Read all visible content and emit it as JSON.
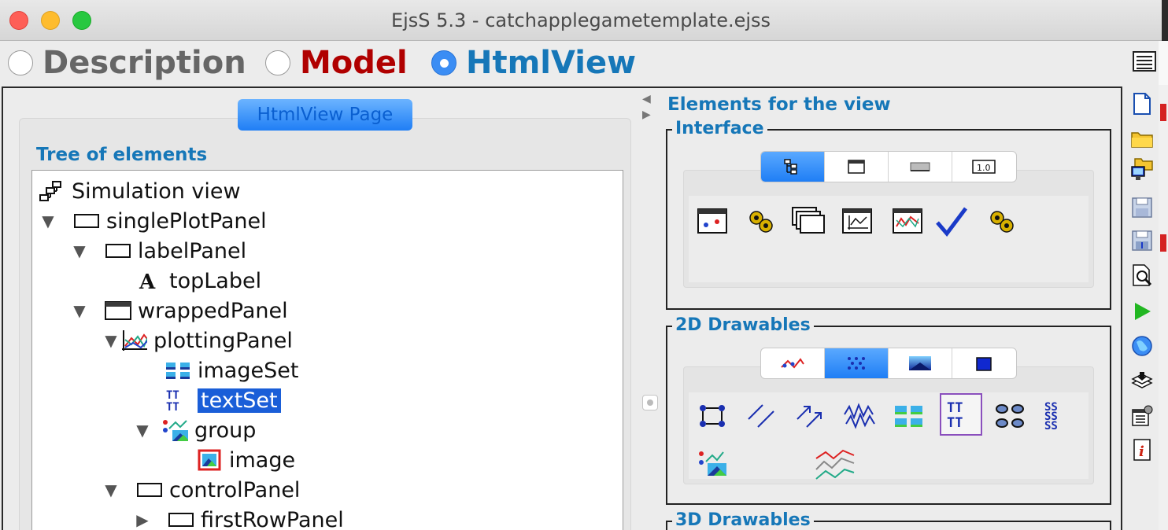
{
  "window": {
    "title": "EjsS 5.3 - catchapplegametemplate.ejss"
  },
  "modes": [
    {
      "label": "Description",
      "selected": false
    },
    {
      "label": "Model",
      "selected": false
    },
    {
      "label": "HtmlView",
      "selected": true
    }
  ],
  "page_tab": {
    "label": "HtmlView Page"
  },
  "tree": {
    "title": "Tree of elements",
    "nodes": [
      {
        "label": "Simulation view",
        "icon": "simulation-view-icon",
        "depth": 0,
        "expander": "none",
        "selected": false
      },
      {
        "label": "singlePlotPanel",
        "icon": "panel-icon",
        "depth": 1,
        "expander": "expanded",
        "selected": false
      },
      {
        "label": "labelPanel",
        "icon": "panel-icon",
        "depth": 2,
        "expander": "expanded",
        "selected": false
      },
      {
        "label": "topLabel",
        "icon": "label-icon",
        "depth": 3,
        "expander": "none",
        "selected": false
      },
      {
        "label": "wrappedPanel",
        "icon": "wrapped-panel-icon",
        "depth": 2,
        "expander": "expanded",
        "selected": false
      },
      {
        "label": "plottingPanel",
        "icon": "plotting-panel-icon",
        "depth": 3,
        "expander": "expanded",
        "selected": false
      },
      {
        "label": "imageSet",
        "icon": "image-set-icon",
        "depth": 4,
        "expander": "none",
        "selected": false
      },
      {
        "label": "textSet",
        "icon": "text-set-icon",
        "depth": 4,
        "expander": "none",
        "selected": true
      },
      {
        "label": "group",
        "icon": "group-icon",
        "depth": 4,
        "expander": "expanded",
        "selected": false
      },
      {
        "label": "image",
        "icon": "image-icon",
        "depth": 5,
        "expander": "none",
        "selected": false
      },
      {
        "label": "controlPanel",
        "icon": "panel-icon",
        "depth": 3,
        "expander": "expanded",
        "selected": false
      },
      {
        "label": "firstRowPanel",
        "icon": "panel-icon",
        "depth": 4,
        "expander": "collapsed",
        "selected": false
      }
    ]
  },
  "elements": {
    "title": "Elements for the view",
    "groups": [
      {
        "title": "Interface",
        "tabs": [
          "tree-tab-icon",
          "window-tab-icon",
          "button-tab-icon",
          "field-tab-icon"
        ],
        "selected_tab": 0,
        "items": [
          "drawing-panel-icon",
          "gear-wrapped-icon",
          "stacked-panels-icon",
          "plotting-panel-icon",
          "plotting-panel-trace-icon",
          "check-icon",
          "gear-icon"
        ]
      },
      {
        "title": "2D Drawables",
        "tabs": [
          "curve-tab-icon",
          "dots-tab-icon",
          "gradient-tab-icon",
          "bar-tab-icon"
        ],
        "selected_tab": 1,
        "items": [
          "arrows-set-icon",
          "segment-set-icon",
          "arrow-set-icon",
          "trail-set-icon",
          "image-set-icon",
          "text-set-icon",
          "shape-set-icon",
          "spring-set-icon",
          "group-icon",
          "trace-set-icon"
        ],
        "selected_item": 5
      },
      {
        "title": "3D Drawables"
      }
    ]
  },
  "tools": [
    "new-file-icon",
    "open-folder-icon",
    "open-remote-icon",
    "save-icon",
    "save-as-icon",
    "search-icon",
    "run-icon",
    "web-icon",
    "library-icon",
    "options-icon",
    "info-icon"
  ],
  "colors": {
    "accent": "#1677b8",
    "model": "#b00000",
    "selection": "#1a5ed8",
    "active_tab": "#1f7ef5"
  }
}
